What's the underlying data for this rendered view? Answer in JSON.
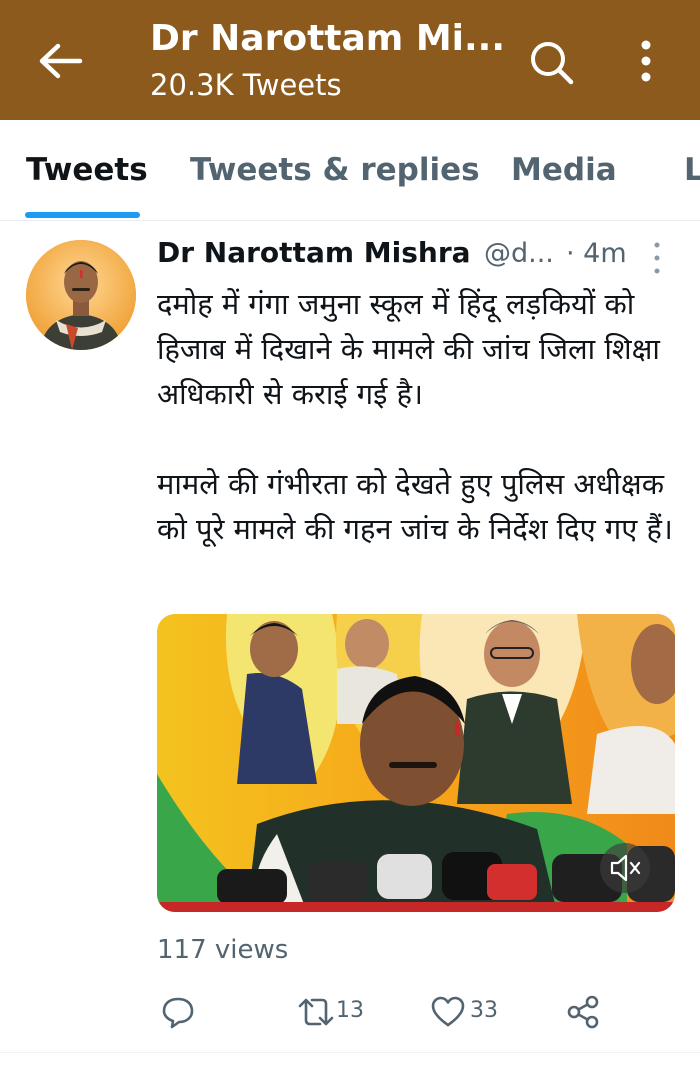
{
  "header": {
    "title": "Dr Narottam Mi...",
    "subtitle": "20.3K Tweets",
    "back_icon": "arrow-left-icon",
    "search_icon": "search-icon",
    "more_icon": "more-vertical-icon",
    "bar_color": "#8c5a1c"
  },
  "tabs": [
    {
      "label": "Tweets",
      "active": true
    },
    {
      "label": "Tweets & replies",
      "active": false
    },
    {
      "label": "Media",
      "active": false
    },
    {
      "label": "L",
      "active": false
    }
  ],
  "accent_color": "#1d9bf0",
  "tweet": {
    "author_name": "Dr Narottam Mishra",
    "handle": "@d...",
    "time": "· 4m",
    "text_paragraph_1": "दमोह में गंगा जमुना स्कूल में हिंदू लड़कियों को हिजाब में दिखाने के मामले की जांच जिला शिक्षा अधिकारी से कराई गई है।",
    "text_paragraph_2": "मामले की गंभीरता को देखते हुए पुलिस अधीक्षक को पूरे मामले की गहन जांच के निर्देश दिए गए हैं।",
    "media_icon": "mute-icon",
    "views": "117 views",
    "actions": {
      "reply_icon": "reply-icon",
      "retweet_icon": "retweet-icon",
      "retweet_count": "13",
      "like_icon": "heart-icon",
      "like_count": "33",
      "share_icon": "share-icon"
    }
  }
}
